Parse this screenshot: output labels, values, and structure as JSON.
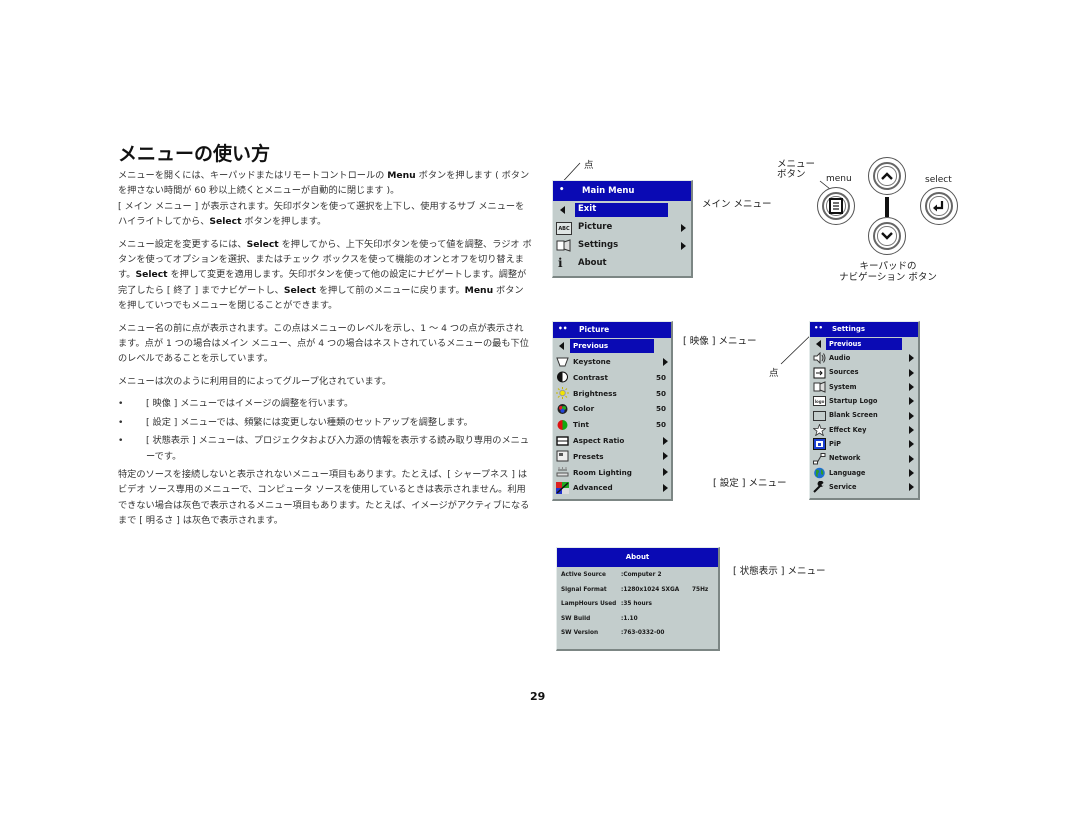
{
  "page": {
    "title": "メニューの使い方",
    "page_number": "29"
  },
  "body": {
    "p1": {
      "a": "メニューを開くには、キーパッドまたはリモートコントロールの ",
      "b": "Menu",
      "c": " ボタンを押します ( ボタンを押さない時間が 60 秒以上続くとメニューが自動的に閉じます )。"
    },
    "p1b": {
      "a": "[ メイン メニュー ] が表示されます。矢印ボタンを使って選択を上下し、使用するサブ メニューをハイライトしてから、",
      "b": "Select",
      "c": " ボタンを押します。"
    },
    "p2": {
      "a": "メニュー設定を変更するには、",
      "b": "Select",
      "c": " を押してから、上下矢印ボタンを使って値を調整、ラジオ ボタンを使ってオプションを選択、またはチェック ボックスを使って機能のオンとオフを切り替えます。",
      "d": "Select",
      "e": " を押して変更を適用します。矢印ボタンを使って他の設定にナビゲートします。調整が完了したら [ 終了 ] までナビゲートし、",
      "f": "Select",
      "g": " を押して前のメニューに戻ります。",
      "h": "Menu",
      "i": " ボタンを押していつでもメニューを閉じることができます。"
    },
    "p3": "メニュー名の前に点が表示されます。この点はメニューのレベルを示し、1 ～ 4 つの点が表示されます。点が 1 つの場合はメイン メニュー、点が 4 つの場合はネストされているメニューの最も下位のレベルであることを示しています。",
    "p4": "メニューは次のように利用目的によってグループ化されています。",
    "bullets": [
      "[ 映像 ] メニューではイメージの調整を行います。",
      "[ 設定 ] メニューでは、頻繁には変更しない種類のセットアップを調整します。",
      "[ 状態表示 ] メニューは、プロジェクタおよび入力源の情報を表示する読み取り専用のメニューです。"
    ],
    "bullet_char": "•",
    "p5": "特定のソースを接続しないと表示されないメニュー項目もあります。たとえば、[ シャープネス ] はビデオ ソース専用のメニューで、コンピュータ ソースを使用しているときは表示されません。利用できない場合は灰色で表示されるメニュー項目もあります。たとえば、イメージがアクティブになるまで [ 明るさ ] は灰色で表示されます。"
  },
  "captions": {
    "dot": "点",
    "main_menu": "メイン メニュー",
    "menu_button_1": "メニュー",
    "menu_button_2": "ボタン",
    "keypad_1": "キーパッドの",
    "keypad_2": "ナビゲーション ボタン",
    "picture_menu": "[ 映像 ] メニュー",
    "settings_menu": "[ 設定 ] メニュー",
    "about_menu": "[ 状態表示 ] メニュー"
  },
  "keypad": {
    "menu_label": "menu",
    "select_label": "select",
    "up_icon": "chevron-up-icon",
    "down_icon": "chevron-down-icon",
    "menu_icon": "menu-list-icon",
    "select_icon": "enter-return-icon"
  },
  "colors": {
    "osd_header": "#0a0ab4",
    "osd_body": "#c3cdcc"
  },
  "main_menu": {
    "dots": "•",
    "title": "Main Menu",
    "items": [
      {
        "label": "Exit",
        "icon": "back-arrow-icon",
        "selected": true
      },
      {
        "label": "Picture",
        "icon": "picture-abc-icon",
        "submenu": true
      },
      {
        "label": "Settings",
        "icon": "settings-projector-icon",
        "submenu": true
      },
      {
        "label": "About",
        "icon": "info-icon",
        "submenu": false
      }
    ]
  },
  "picture_menu": {
    "dots": "••",
    "title": "Picture",
    "items": [
      {
        "label": "Previous",
        "icon": "back-arrow-icon",
        "selected": true
      },
      {
        "label": "Keystone",
        "icon": "keystone-icon",
        "submenu": true
      },
      {
        "label": "Contrast",
        "icon": "contrast-icon",
        "value": "50"
      },
      {
        "label": "Brightness",
        "icon": "brightness-icon",
        "value": "50"
      },
      {
        "label": "Color",
        "icon": "color-icon",
        "value": "50"
      },
      {
        "label": "Tint",
        "icon": "tint-icon",
        "value": "50"
      },
      {
        "label": "Aspect Ratio",
        "icon": "aspect-ratio-icon",
        "submenu": true
      },
      {
        "label": "Presets",
        "icon": "presets-icon",
        "submenu": true
      },
      {
        "label": "Room Lighting",
        "icon": "room-lighting-icon",
        "submenu": true
      },
      {
        "label": "Advanced",
        "icon": "advanced-icon",
        "submenu": true
      }
    ]
  },
  "settings_menu": {
    "dots": "••",
    "title": "Settings",
    "items": [
      {
        "label": "Previous",
        "icon": "back-arrow-icon",
        "selected": true
      },
      {
        "label": "Audio",
        "icon": "audio-icon",
        "submenu": true
      },
      {
        "label": "Sources",
        "icon": "sources-icon",
        "submenu": true
      },
      {
        "label": "System",
        "icon": "system-icon",
        "submenu": true
      },
      {
        "label": "Startup Logo",
        "icon": "startup-logo-icon",
        "submenu": true
      },
      {
        "label": "Blank Screen",
        "icon": "blank-screen-icon",
        "submenu": true
      },
      {
        "label": "Effect Key",
        "icon": "effect-key-icon",
        "submenu": true
      },
      {
        "label": "PiP",
        "icon": "pip-icon",
        "submenu": true
      },
      {
        "label": "Network",
        "icon": "network-icon",
        "submenu": true
      },
      {
        "label": "Language",
        "icon": "language-globe-icon",
        "submenu": true
      },
      {
        "label": "Service",
        "icon": "service-wrench-icon",
        "submenu": true
      }
    ]
  },
  "about_menu": {
    "title": "About",
    "rows": [
      {
        "label": "Active Source",
        "value": ":Computer 2",
        "extra": ""
      },
      {
        "label": "Signal Format",
        "value": ":1280x1024 SXGA",
        "extra": "75Hz"
      },
      {
        "label": "LampHours Used",
        "value": ":35 hours",
        "extra": ""
      },
      {
        "label": "SW Build",
        "value": ":1.10",
        "extra": ""
      },
      {
        "label": "SW Version",
        "value": ":763-0332-00",
        "extra": ""
      }
    ]
  }
}
